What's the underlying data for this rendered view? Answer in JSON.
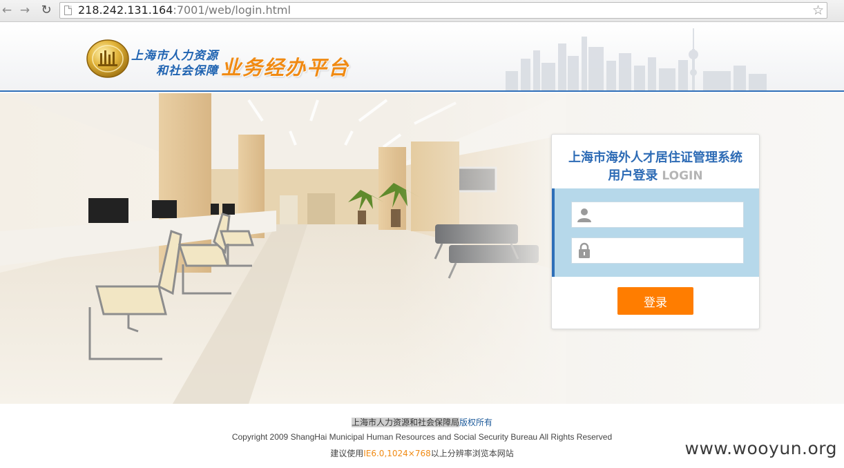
{
  "browser": {
    "url_host": "218.242.131.164",
    "url_rest": ":7001/web/login.html"
  },
  "header": {
    "logo_line1": "上海市人力资源",
    "logo_line2": "和社会保障",
    "brand_title": "业务经办平台"
  },
  "login": {
    "system_title": "上海市海外人才居住证管理系统",
    "subtitle": "用户登录",
    "subtitle_en": "LOGIN",
    "username_value": "",
    "password_value": "",
    "submit_label": "登录"
  },
  "footer": {
    "owner": "上海市人力资源和社会保障局",
    "rights": "版权所有",
    "copyright": "Copyright 2009 ShangHai Municipal Human Resources and Social Security Bureau All Rights Reserved",
    "browser_tip_prefix": "建议使用",
    "browser_tip_highlight": "IE6.0,1024×768",
    "browser_tip_suffix": "以上分辨率浏览本网站"
  },
  "watermark": "www.wooyun.org",
  "colors": {
    "brand_blue": "#2d6bb5",
    "brand_orange": "#f08a13",
    "button_orange": "#ff7d00",
    "login_band": "#b6d8ea"
  },
  "icons": [
    "back-arrow-icon",
    "forward-arrow-icon",
    "reload-icon",
    "page-icon",
    "bookmark-star-icon",
    "user-icon",
    "lock-icon",
    "emblem-logo"
  ]
}
